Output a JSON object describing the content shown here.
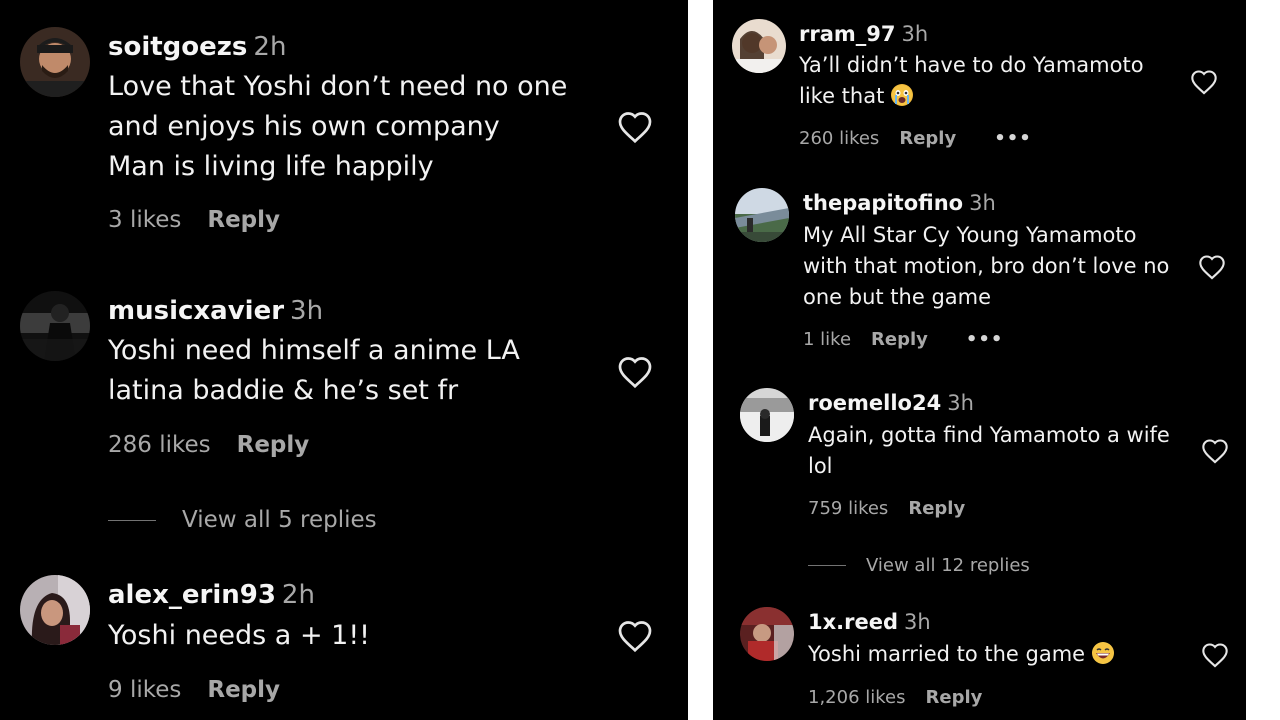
{
  "left": {
    "comments": [
      {
        "username": "soitgoezs",
        "time": "2h",
        "text": "Love that Yoshi don’t need no one\nand enjoys his own company\nMan is living life happily",
        "likes": "3 likes",
        "reply": "Reply"
      },
      {
        "username": "musicxavier",
        "time": "3h",
        "text": "Yoshi need himself a anime LA\nlatina baddie & he’s set fr",
        "likes": "286 likes",
        "reply": "Reply"
      },
      {
        "username": "alex_erin93",
        "time": "2h",
        "text": "Yoshi needs a + 1!!",
        "likes": "9 likes",
        "reply": "Reply"
      }
    ],
    "view_replies": "View all 5 replies"
  },
  "right": {
    "comments": [
      {
        "username": "rram_97",
        "time": "3h",
        "text": "Ya’ll didn’t have to do Yamamoto\nlike that ",
        "emoji": "crying-face-emoji",
        "likes": "260 likes",
        "reply": "Reply",
        "more": "•••"
      },
      {
        "username": "thepapitofino",
        "time": "3h",
        "text": "My All Star Cy Young Yamamoto\nwith that motion, bro don’t love no\none but the game",
        "likes": "1 like",
        "reply": "Reply",
        "more": "•••"
      },
      {
        "username": "roemello24",
        "time": "3h",
        "text": "Again, gotta find Yamamoto a wife\nlol",
        "likes": "759 likes",
        "reply": "Reply"
      },
      {
        "username": "1x.reed",
        "time": "3h",
        "text": "Yoshi married to the game ",
        "emoji": "grinning-face-emoji",
        "likes": "1,206 likes",
        "reply": "Reply"
      }
    ],
    "view_replies": "View all 12 replies"
  }
}
